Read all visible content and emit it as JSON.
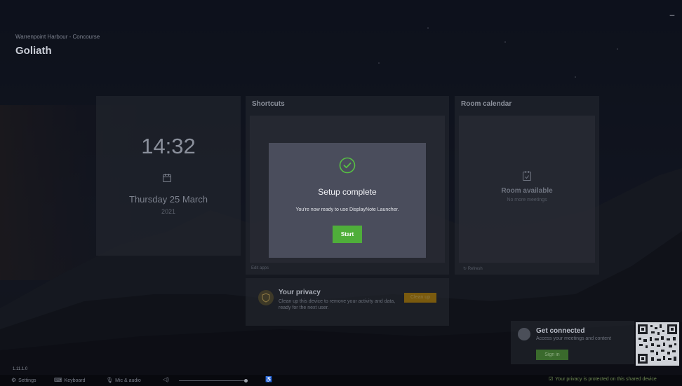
{
  "header": {
    "location": "Warrenpoint Harbour - Concourse",
    "room_name": "Goliath",
    "minimize_icon": "minimize-icon"
  },
  "clock": {
    "time": "14:32",
    "date": "Thursday 25 March",
    "year": "2021",
    "icon": "calendar-icon"
  },
  "shortcuts": {
    "title": "Shortcuts",
    "footer": "Edit apps"
  },
  "room_calendar": {
    "title": "Room calendar",
    "status": "Room available",
    "subtitle": "No more meetings",
    "footer": "Refresh",
    "icon": "calendar-check-icon"
  },
  "privacy": {
    "title": "Your privacy",
    "body": "Clean up this device to remove your activity and data, ready for the next user.",
    "button": "Clean up",
    "icon": "shield-icon"
  },
  "connect": {
    "title": "Get connected",
    "subtitle": "Access your meetings and content",
    "button": "Sign in"
  },
  "modal": {
    "title": "Setup complete",
    "message": "You're now ready to use DisplayNote Launcher.",
    "button": "Start",
    "icon": "check-circle-icon",
    "accent": "#4fae3a"
  },
  "footer": {
    "version": "1.11.1.0",
    "settings": "Settings",
    "keyboard": "Keyboard",
    "mic": "Mic & audio",
    "volume_level": 0.97,
    "privacy_note": "Your privacy is protected on this shared device"
  },
  "colors": {
    "modal_bg": "#4a4d5c",
    "start_button": "#4fae3a",
    "cleanup_button": "#7a5a0e",
    "signin_button": "#3a6a2c"
  }
}
